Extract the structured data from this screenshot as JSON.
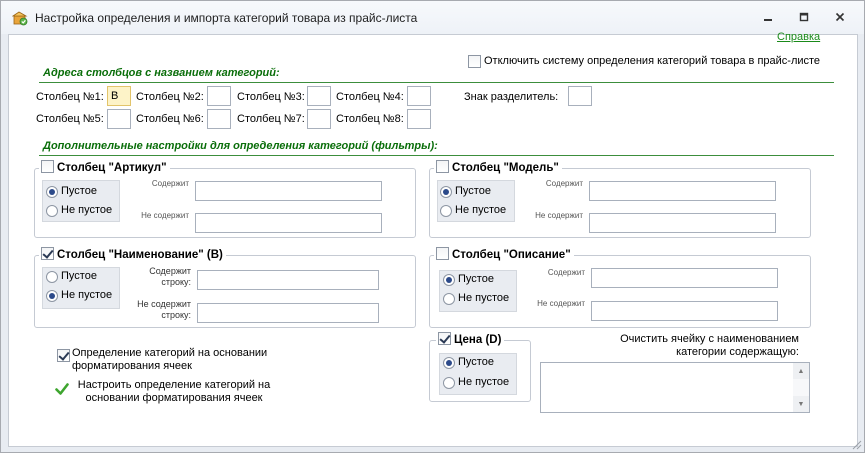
{
  "window": {
    "title": "Настройка определения и импорта категорий товара из прайс-листа"
  },
  "header": {
    "help_link": "Справка",
    "disable_label": "Отключить систему определения категорий товара в прайс-листе"
  },
  "columns_section": {
    "title": "Адреса столбцов с названием категорий:",
    "fields": [
      {
        "label": "Столбец №1:",
        "value": "B"
      },
      {
        "label": "Столбец №2:",
        "value": ""
      },
      {
        "label": "Столбец №3:",
        "value": ""
      },
      {
        "label": "Столбец №4:",
        "value": ""
      },
      {
        "label": "Столбец №5:",
        "value": ""
      },
      {
        "label": "Столбец №6:",
        "value": ""
      },
      {
        "label": "Столбец №7:",
        "value": ""
      },
      {
        "label": "Столбец №8:",
        "value": ""
      }
    ],
    "separator_label": "Знак разделитель:",
    "separator_value": ""
  },
  "filters_section": {
    "title": "Дополнительные настройки для определения категорий (фильтры):",
    "groups": {
      "article": {
        "title": "Столбец \"Артикул\"",
        "checked": false,
        "empty": "Пустое",
        "not_empty": "Не пустое",
        "contains": "Содержит",
        "not_contains": "Не содержит"
      },
      "model": {
        "title": "Столбец \"Модель\"",
        "checked": false,
        "empty": "Пустое",
        "not_empty": "Не пустое",
        "contains": "Содержит",
        "not_contains": "Не содержит"
      },
      "name": {
        "title": "Столбец \"Наименование\" (B)",
        "checked": true,
        "empty": "Пустое",
        "not_empty": "Не пустое",
        "contains": "Содержит строку:",
        "not_contains": "Не содержит строку:"
      },
      "description": {
        "title": "Столбец \"Описание\"",
        "checked": false,
        "empty": "Пустое",
        "not_empty": "Не пустое",
        "contains": "Содержит",
        "not_contains": "Не содержит"
      },
      "price": {
        "title": "Цена (D)",
        "checked": true,
        "empty": "Пустое",
        "not_empty": "Не пустое"
      }
    }
  },
  "formatting": {
    "checkbox_label_1": "Определение категорий на основании",
    "checkbox_label_2": "форматирования ячеек",
    "checked": true,
    "configure_label_1": "Настроить определение категорий на",
    "configure_label_2": "основании форматирования ячеек"
  },
  "clear_cell": {
    "label_1": "Очистить ячейку с наименованием",
    "label_2": "категории содержащую:",
    "value": ""
  },
  "colors": {
    "section_title": "#0a6e0a",
    "link": "#1a8a1a",
    "active_field": "#fdf3c8"
  }
}
